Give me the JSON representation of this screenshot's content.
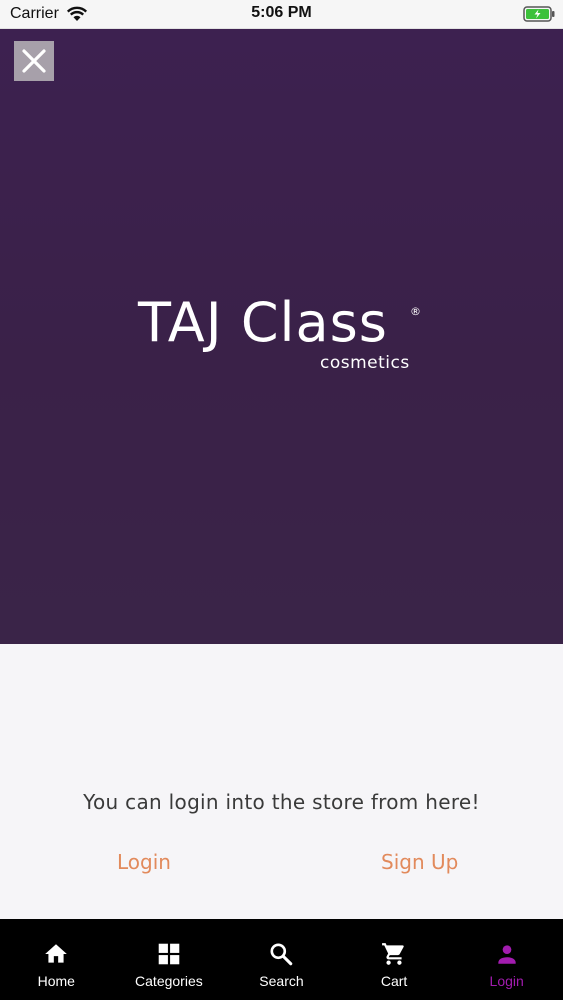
{
  "status_bar": {
    "carrier": "Carrier",
    "time": "5:06 PM"
  },
  "hero": {
    "brand_name": "TAJ Class",
    "registered_mark": "®",
    "brand_tagline": "cosmetics",
    "background_color": "#3b2149"
  },
  "content": {
    "message": "You can login into the store from here!",
    "login_label": "Login",
    "signup_label": "Sign Up",
    "link_color": "#e28a5c"
  },
  "tab_bar": {
    "active_color": "#a21caf",
    "items": [
      {
        "label": "Home",
        "icon": "home-icon"
      },
      {
        "label": "Categories",
        "icon": "grid-icon"
      },
      {
        "label": "Search",
        "icon": "search-icon"
      },
      {
        "label": "Cart",
        "icon": "cart-icon"
      },
      {
        "label": "Login",
        "icon": "person-icon",
        "active": true
      }
    ]
  }
}
